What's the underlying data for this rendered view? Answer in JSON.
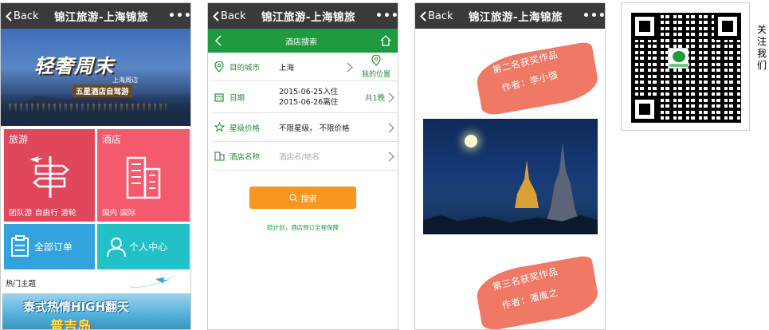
{
  "screen1": {
    "back": "Back",
    "title": "锦江旅游-上海锦旅",
    "more": "•••",
    "banner": {
      "title": "轻奢周末",
      "subtitle1": "上海周边",
      "subtitle2": "五星酒店自驾游"
    },
    "tiles": [
      {
        "title": "旅游",
        "sub": "团队游 自由行 游轮",
        "color": "#e0475c"
      },
      {
        "title": "酒店",
        "sub": "国内 国际",
        "color": "#f35a6d"
      },
      {
        "title": "全部订单",
        "color": "#33a3de"
      },
      {
        "title": "个人中心",
        "color": "#22c1c7"
      }
    ],
    "section_title": "热门主题",
    "promo": {
      "line1": "泰式热情HIGH翻天",
      "line2": "普吉岛"
    }
  },
  "screen2": {
    "back": "Back",
    "title": "锦江旅游-上海锦旅",
    "more": "•••",
    "header": "酒店搜索",
    "rows": [
      {
        "label": "目的城市",
        "value": "上海",
        "extra": "我的位置"
      },
      {
        "label": "日期",
        "value1": "2015-06-25入住",
        "value2": "2015-06-26离住",
        "extra": "共1晚"
      },
      {
        "label": "星级价格",
        "value": "不限星级， 不限价格"
      },
      {
        "label": "酒店名称",
        "placeholder": "酒店名/地名"
      }
    ],
    "search_label": "搜索",
    "note": "赔计划，酒店预订全程保障"
  },
  "screen3": {
    "back": "Back",
    "title": "锦江旅游-上海锦旅",
    "more": "•••",
    "award1": {
      "line1": "第二名获奖作品",
      "line2": "作者：李小强"
    },
    "award2": {
      "line1": "第三名获奖作品",
      "line2": "作者：潘胤之"
    }
  },
  "qr": {
    "side_text": "关注我们"
  },
  "colors": {
    "topbar": "#3a3a3a",
    "green": "#1f9a3f",
    "orange": "#f8961d",
    "brush": "#f07966"
  }
}
